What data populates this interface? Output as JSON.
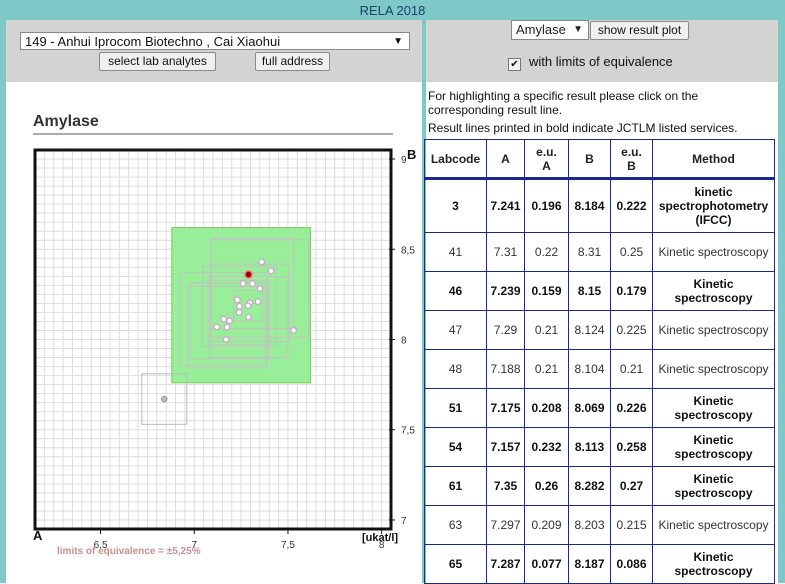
{
  "app": {
    "title": "RELA 2018"
  },
  "lab_select": {
    "value": "149 - Anhui Iprocom Biotechno , Cai Xiaohui"
  },
  "buttons": {
    "select_lab_analytes": "select lab analytes",
    "full_address": "full address",
    "show_result_plot": "show result plot"
  },
  "analyte_select": {
    "value": "Amylase"
  },
  "equivalence_checkbox": {
    "label": "with limits of equivalence",
    "checked": true
  },
  "chart": {
    "title": "Amylase",
    "corner_a": "A",
    "corner_b": "B",
    "limits_label": "limits of equivalence = ±5,25%"
  },
  "info": {
    "line1": "For highlighting a specific result please click on the",
    "line2": "corresponding result line.",
    "line3": "Result lines printed in bold indicate JCTLM listed services."
  },
  "table": {
    "headers": {
      "labcode": "Labcode",
      "a": "A",
      "eu_a_1": "e.u.",
      "eu_a_2": "A",
      "b": "B",
      "eu_b_1": "e.u.",
      "eu_b_2": "B",
      "method": "Method"
    },
    "rows": [
      {
        "labcode": "3",
        "a": "7.241",
        "eua": "0.196",
        "b": "8.184",
        "eub": "0.222",
        "method": "kinetic spectrophotometry (IFCC)",
        "bold": true
      },
      {
        "labcode": "41",
        "a": "7.31",
        "eua": "0.22",
        "b": "8.31",
        "eub": "0.25",
        "method": "Kinetic spectroscopy",
        "bold": false
      },
      {
        "labcode": "46",
        "a": "7.239",
        "eua": "0.159",
        "b": "8.15",
        "eub": "0.179",
        "method": "Kinetic spectroscopy",
        "bold": true
      },
      {
        "labcode": "47",
        "a": "7.29",
        "eua": "0.21",
        "b": "8.124",
        "eub": "0.225",
        "method": "Kinetic spectroscopy",
        "bold": false
      },
      {
        "labcode": "48",
        "a": "7.188",
        "eua": "0.21",
        "b": "8.104",
        "eub": "0.21",
        "method": "Kinetic spectroscopy",
        "bold": false
      },
      {
        "labcode": "51",
        "a": "7.175",
        "eua": "0.208",
        "b": "8.069",
        "eub": "0.226",
        "method": "Kinetic spectroscopy",
        "bold": true
      },
      {
        "labcode": "54",
        "a": "7.157",
        "eua": "0.232",
        "b": "8.113",
        "eub": "0.258",
        "method": "Kinetic spectroscopy",
        "bold": true
      },
      {
        "labcode": "61",
        "a": "7.35",
        "eua": "0.26",
        "b": "8.282",
        "eub": "0.27",
        "method": "Kinetic spectroscopy",
        "bold": true
      },
      {
        "labcode": "63",
        "a": "7.297",
        "eua": "0.209",
        "b": "8.203",
        "eub": "0.215",
        "method": "Kinetic spectroscopy",
        "bold": false
      },
      {
        "labcode": "65",
        "a": "7.287",
        "eua": "0.077",
        "b": "8.187",
        "eub": "0.086",
        "method": "Kinetic spectroscopy",
        "bold": true
      }
    ]
  },
  "chart_data": {
    "type": "scatter",
    "title": "Amylase",
    "xlabel": "A",
    "ylabel": "B",
    "unit": "[ukat/l]",
    "xlim": [
      6.15,
      8.05
    ],
    "ylim": [
      6.95,
      9.05
    ],
    "x_ticks": [
      "6,5",
      "7",
      "7,5",
      "8"
    ],
    "x_tick_values": [
      6.5,
      7,
      7.5,
      8
    ],
    "y_ticks": [
      "7",
      "7,5",
      "8",
      "8,5",
      "9"
    ],
    "y_tick_values": [
      7,
      7.5,
      8,
      8.5,
      9
    ],
    "grid": true,
    "limits_of_equivalence_pct": 5.25,
    "equivalence_box": {
      "x": [
        6.88,
        7.62
      ],
      "y": [
        7.76,
        8.62
      ]
    },
    "colors": {
      "box_fill": "#99ee99",
      "box_stroke": "#77cc55",
      "highlight": "#8b0000",
      "point": "#c8a8c8",
      "outlier": "#bbbbbb",
      "grid": "#dddddd"
    },
    "highlighted_point": {
      "x": 7.29,
      "y": 8.36
    },
    "points": [
      {
        "x": 7.241,
        "y": 8.184
      },
      {
        "x": 7.31,
        "y": 8.31
      },
      {
        "x": 7.239,
        "y": 8.15
      },
      {
        "x": 7.29,
        "y": 8.124
      },
      {
        "x": 7.188,
        "y": 8.104
      },
      {
        "x": 7.175,
        "y": 8.069
      },
      {
        "x": 7.157,
        "y": 8.113
      },
      {
        "x": 7.35,
        "y": 8.282
      },
      {
        "x": 7.297,
        "y": 8.203
      },
      {
        "x": 7.287,
        "y": 8.187
      },
      {
        "x": 7.36,
        "y": 8.43
      },
      {
        "x": 7.41,
        "y": 8.38
      },
      {
        "x": 7.23,
        "y": 8.22
      },
      {
        "x": 7.17,
        "y": 8.0
      },
      {
        "x": 7.12,
        "y": 8.07
      },
      {
        "x": 7.26,
        "y": 8.31
      },
      {
        "x": 7.53,
        "y": 8.05
      },
      {
        "x": 7.34,
        "y": 8.21
      }
    ],
    "outlier_point": {
      "x": 6.84,
      "y": 7.67
    }
  }
}
